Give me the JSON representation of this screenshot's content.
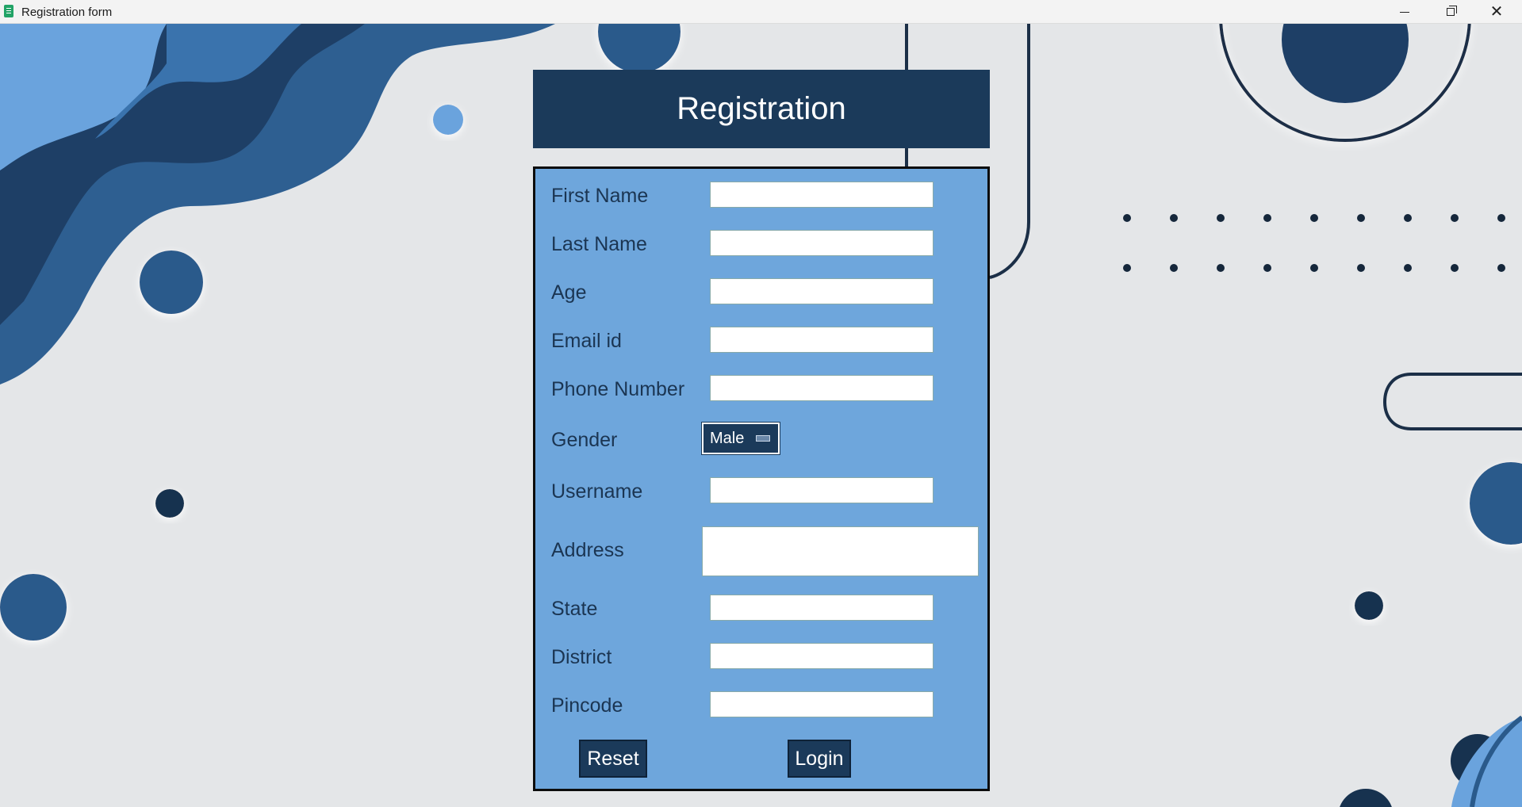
{
  "window": {
    "title": "Registration form"
  },
  "form": {
    "heading": "Registration",
    "fields": [
      {
        "label": "First Name",
        "value": ""
      },
      {
        "label": "Last Name",
        "value": ""
      },
      {
        "label": "Age",
        "value": ""
      },
      {
        "label": "Email id",
        "value": ""
      },
      {
        "label": "Phone Number",
        "value": ""
      },
      {
        "label": "Gender",
        "value": "Male"
      },
      {
        "label": "Username",
        "value": ""
      },
      {
        "label": "Address",
        "value": ""
      },
      {
        "label": "State",
        "value": ""
      },
      {
        "label": "District",
        "value": ""
      },
      {
        "label": "Pincode",
        "value": ""
      }
    ],
    "reset_label": "Reset",
    "login_label": "Login"
  },
  "colors": {
    "navy": "#1b3a5a",
    "panel_blue": "#6ea6dc",
    "background": "#e4e6e8"
  }
}
